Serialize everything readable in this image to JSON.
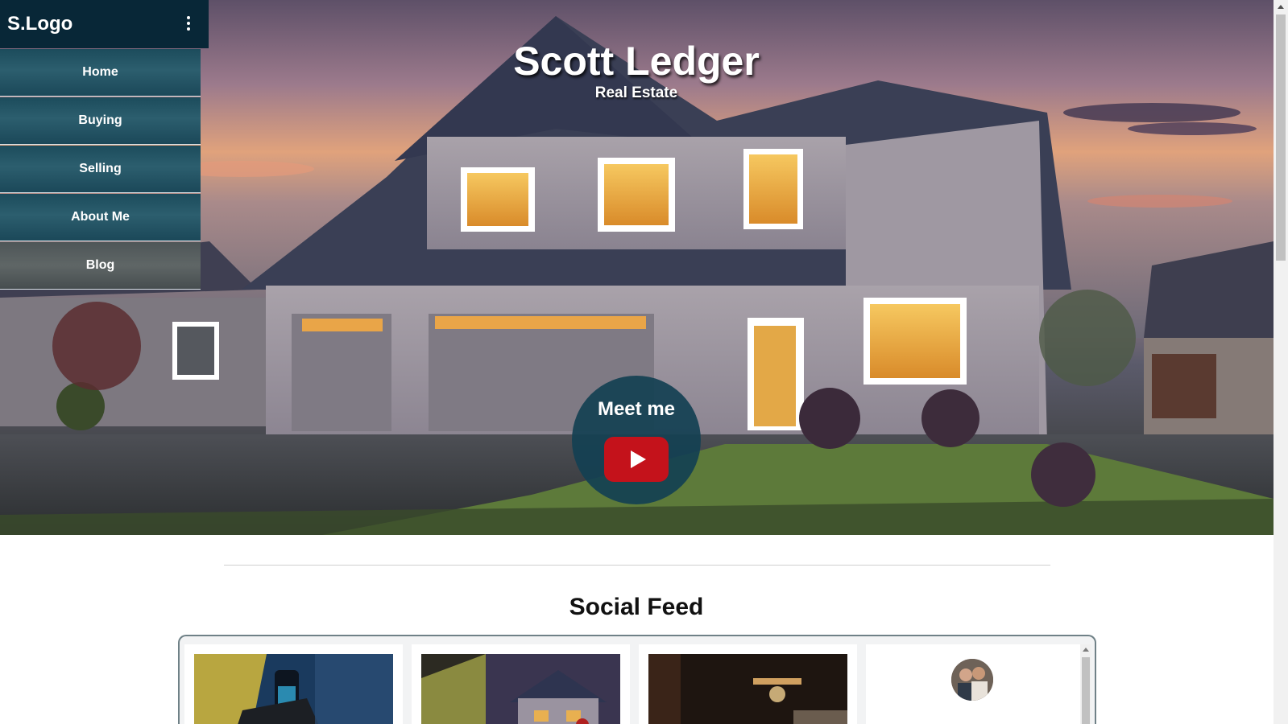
{
  "brand": {
    "logo_text": "S.Logo"
  },
  "nav": {
    "items": [
      {
        "label": "Home"
      },
      {
        "label": "Buying"
      },
      {
        "label": "Selling"
      },
      {
        "label": "About Me"
      },
      {
        "label": "Blog"
      }
    ]
  },
  "hero": {
    "title": "Scott Ledger",
    "subtitle": "Real Estate",
    "video_button": {
      "label": "Meet me",
      "icon": "youtube-play-icon"
    }
  },
  "social": {
    "heading": "Social Feed",
    "posts": [
      {
        "type": "image",
        "icon": "photo-desk-bottle"
      },
      {
        "type": "image",
        "icon": "photo-house-screen"
      },
      {
        "type": "image",
        "icon": "photo-dark-interior"
      },
      {
        "type": "profile",
        "icon": "avatar"
      }
    ]
  },
  "colors": {
    "nav_dark": "#082737",
    "nav_item": "#2c5e6e",
    "meet_badge": "#134052",
    "play_red": "#c4121b"
  }
}
